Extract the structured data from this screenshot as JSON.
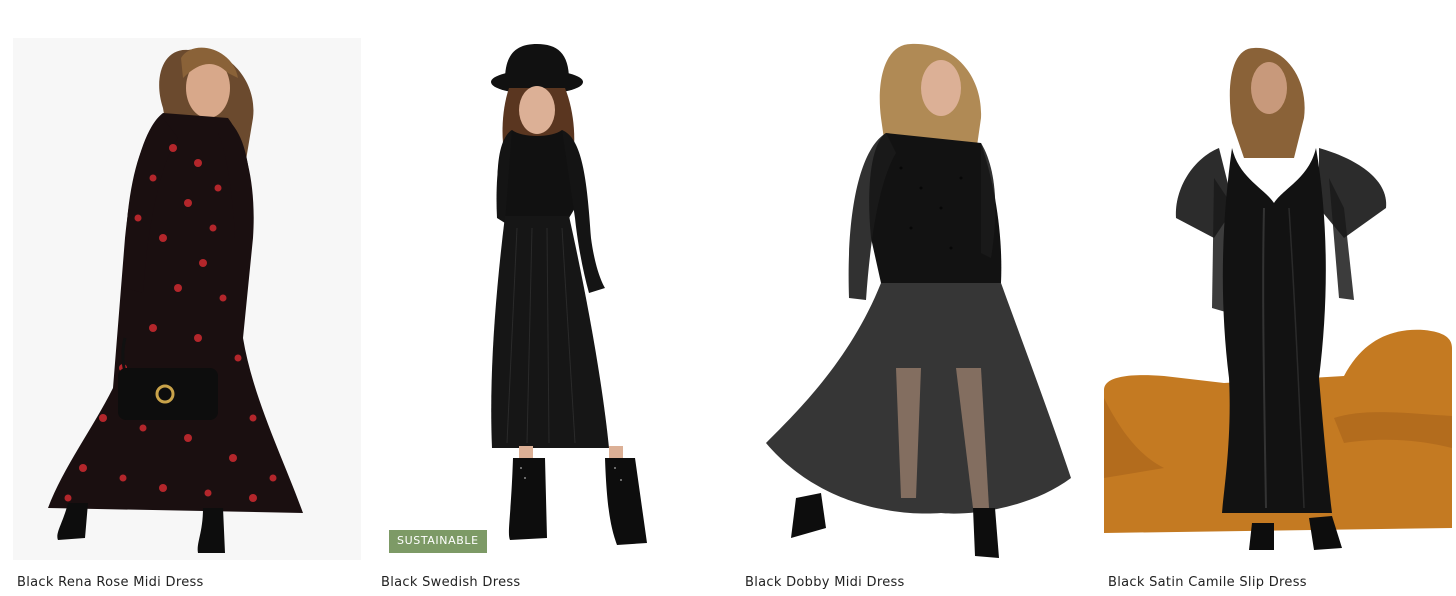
{
  "products": [
    {
      "name": "Black Rena Rose Midi Dress",
      "image_alt": "Black Rena Rose Midi Dress",
      "badge": ""
    },
    {
      "name": "Black Swedish Dress",
      "image_alt": "Black Swedish Dress",
      "badge": "SUSTAINABLE"
    },
    {
      "name": "Black Dobby Midi Dress",
      "image_alt": "Black Dobby Midi Dress",
      "badge": ""
    },
    {
      "name": "Black Satin Camile Slip Dress",
      "image_alt": "Black Satin Camile Slip Dress",
      "badge": ""
    }
  ],
  "colors": {
    "badge_background": "#7d9a66",
    "text": "#222222",
    "dress": "#111111",
    "rose_print": "#b3262b",
    "sofa": "#c47a22"
  }
}
